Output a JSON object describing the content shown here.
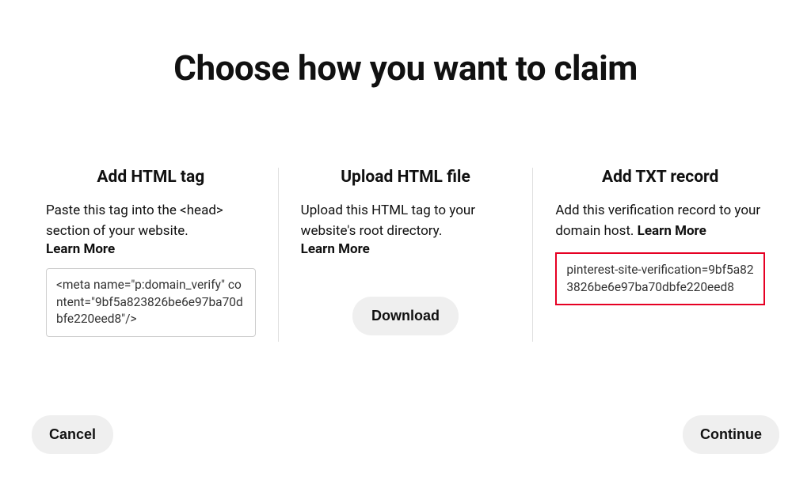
{
  "title": "Choose how you want to claim",
  "columns": {
    "html_tag": {
      "title": "Add HTML tag",
      "desc": "Paste this tag into the <head> section of your website. ",
      "learn_more": "Learn More",
      "code": "<meta name=\"p:domain_verify\" content=\"9bf5a823826be6e97ba70dbfe220eed8\"/>"
    },
    "html_file": {
      "title": "Upload HTML file",
      "desc": "Upload this HTML tag to your website's root directory. ",
      "learn_more": "Learn More",
      "download_label": "Download"
    },
    "txt_record": {
      "title": "Add TXT record",
      "desc": "Add this verification record to your domain host. ",
      "learn_more": "Learn More",
      "code": "pinterest-site-verification=9bf5a823826be6e97ba70dbfe220eed8"
    }
  },
  "footer": {
    "cancel": "Cancel",
    "continue": "Continue"
  }
}
